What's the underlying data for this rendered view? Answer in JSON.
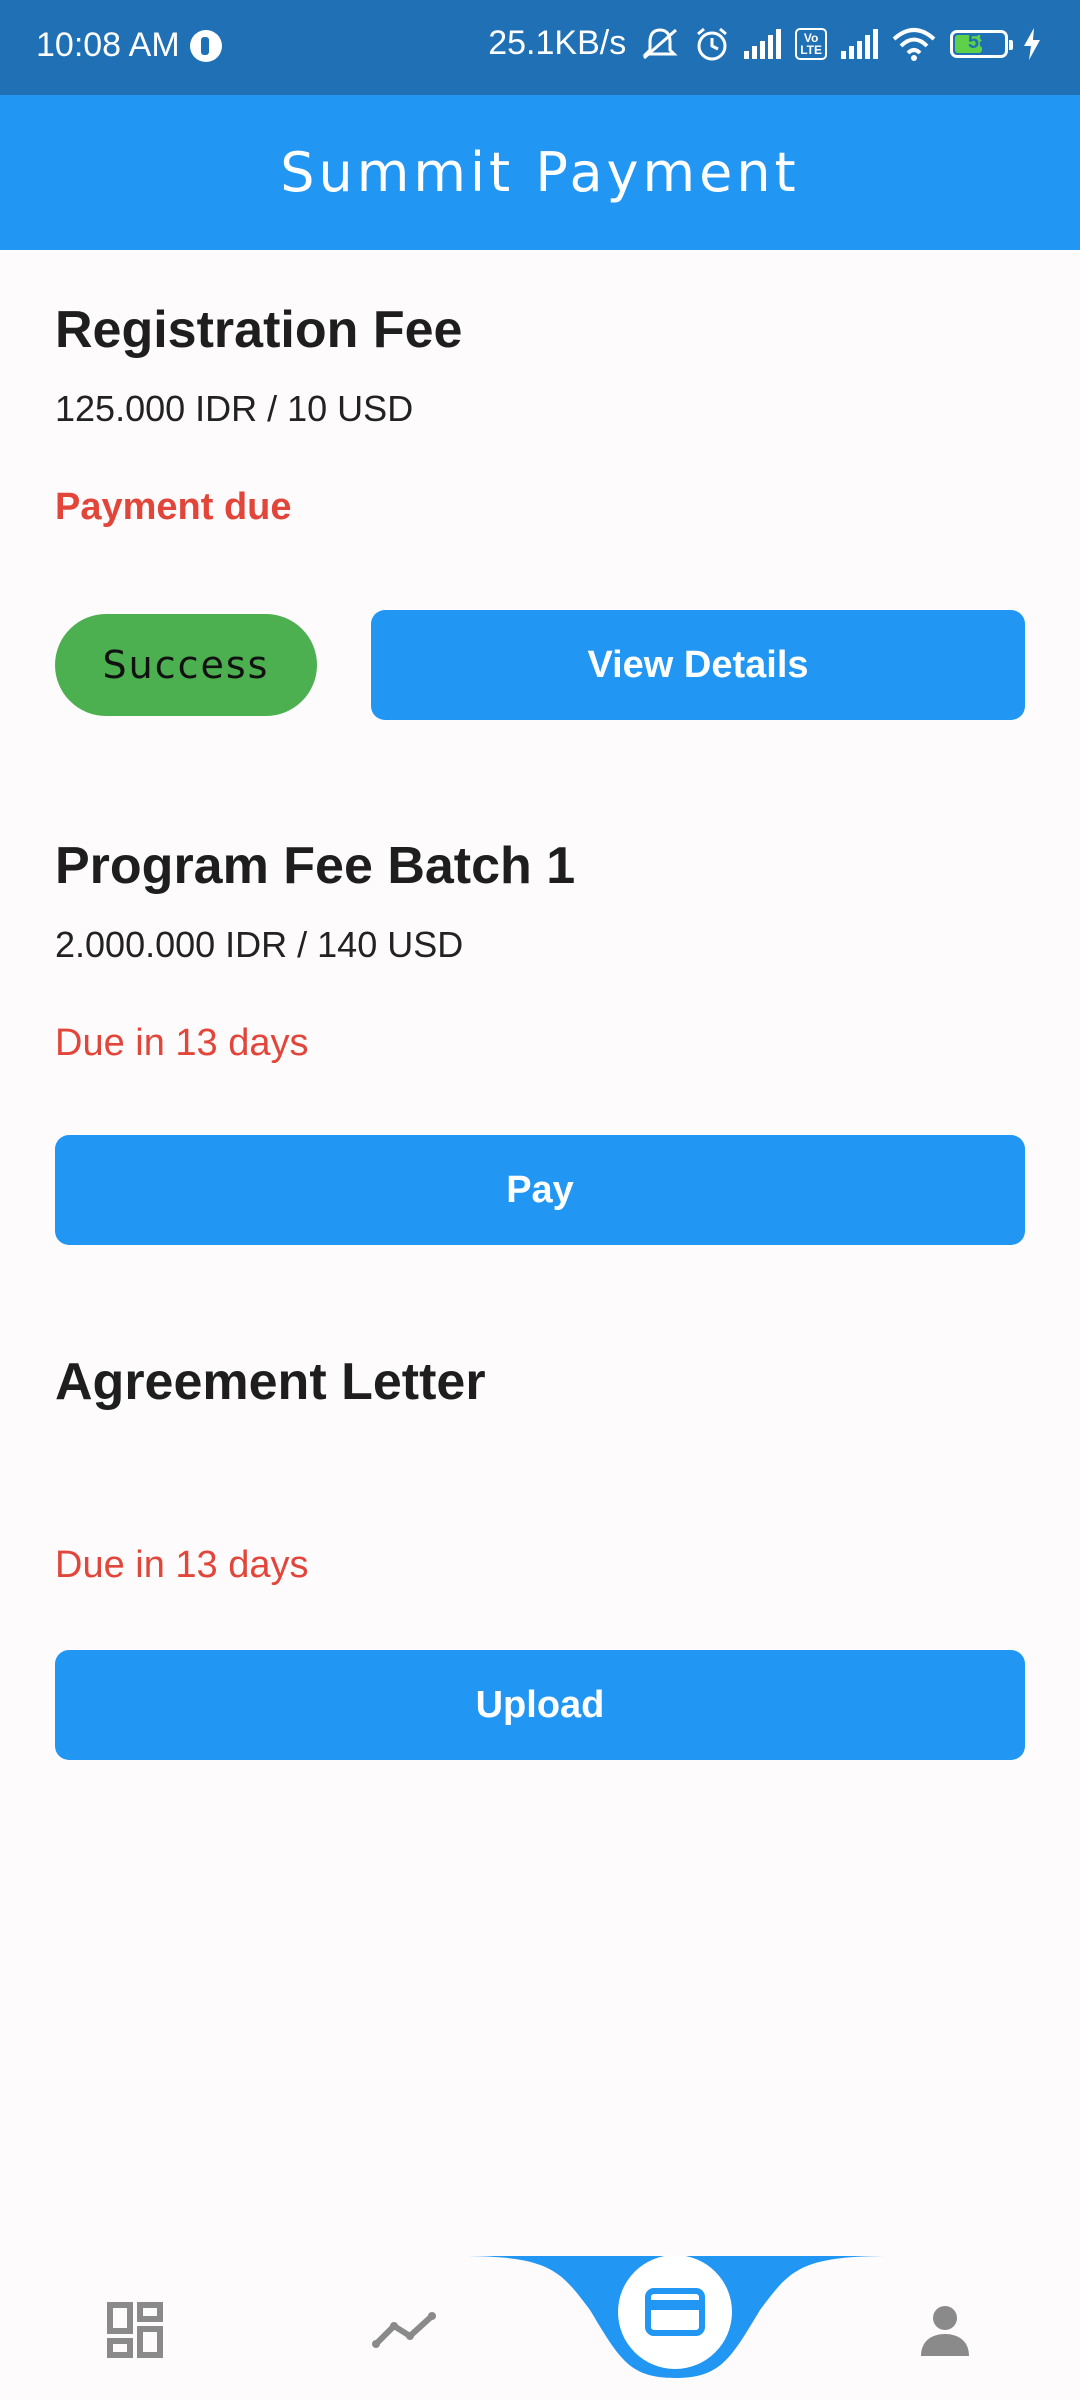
{
  "status_bar": {
    "time": "10:08 AM",
    "net_speed": "25.1KB/s",
    "volte_label": "Vo\nLTE",
    "battery": "58"
  },
  "app_bar": {
    "title": "Summit Payment"
  },
  "items": [
    {
      "title": "Registration Fee",
      "price": "125.000 IDR / 10 USD",
      "status": "Payment due",
      "chip_label": "Success",
      "button_label": "View Details"
    },
    {
      "title": "Program Fee Batch 1",
      "price": "2.000.000 IDR / 140 USD",
      "status": "Due in 13 days",
      "button_label": "Pay"
    },
    {
      "title": "Agreement Letter",
      "status": "Due in 13 days",
      "button_label": "Upload"
    }
  ],
  "bottom_nav": {
    "items": [
      {
        "icon": "dashboard-icon"
      },
      {
        "icon": "trend-icon"
      },
      {
        "icon": "card-icon",
        "active": true
      },
      {
        "icon": "person-icon"
      }
    ]
  },
  "colors": {
    "primary": "#2196f3",
    "status_bar": "#1f70b5",
    "success": "#4caf50",
    "due_red": "#e2463a",
    "nav_inactive": "#8a8a8a"
  }
}
